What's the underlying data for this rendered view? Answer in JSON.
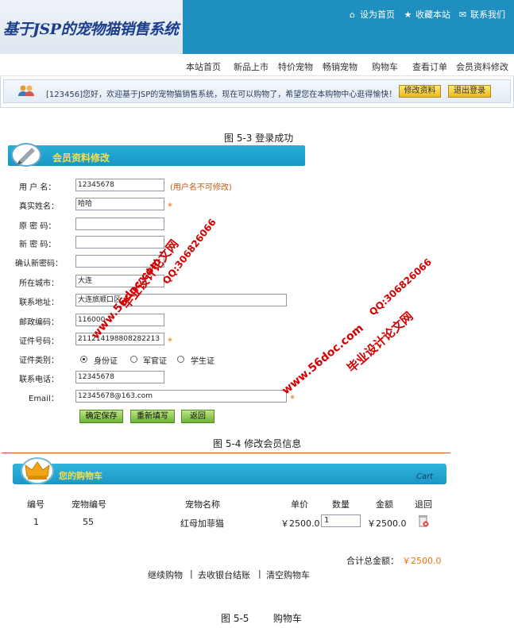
{
  "site": {
    "logo_text": "基于JSP的宠物猫销售系统",
    "toplinks": [
      {
        "icon": "home-icon",
        "label": "设为首页"
      },
      {
        "icon": "star-icon",
        "label": "收藏本站"
      },
      {
        "icon": "mail-icon",
        "label": "联系我们"
      }
    ],
    "nav": [
      "本站首页",
      "新品上市",
      "特价宠物",
      "畅销宠物",
      "购物车",
      "查看订单",
      "会员资料修改"
    ],
    "welcome": "[123456]您好，欢迎基于JSP的宠物猫销售系统，现在可以购物了，希望您在本购物中心逛得愉快！",
    "btn_edit": "修改资料",
    "btn_logout": "退出登录"
  },
  "captions": {
    "fig3": "图 5-3  登录成功",
    "fig4": "图 5-4  修改会员信息",
    "fig5": "图 5-5        购物车"
  },
  "form": {
    "title": "会员资料修改",
    "fields": [
      {
        "label": "用 户 名：",
        "value": "12345678",
        "note": "(用户名不可修改)"
      },
      {
        "label": "真实姓名：",
        "value": "哈哈",
        "required": "*"
      },
      {
        "label": "原 密 码：",
        "value": ""
      },
      {
        "label": "新 密 码：",
        "value": ""
      },
      {
        "label": "确认新密码：",
        "value": ""
      },
      {
        "label": "所在城市：",
        "value": "大连"
      },
      {
        "label": "联系地址：",
        "value": "大连旅顺口区"
      },
      {
        "label": "邮政编码：",
        "value": "116000"
      },
      {
        "label": "证件号码：",
        "value": "211214198808282213",
        "required": "*"
      },
      {
        "label": "证件类别：",
        "options": [
          "身份证",
          "军官证",
          "学生证"
        ],
        "selected": "身份证"
      },
      {
        "label": "联系电话：",
        "value": "12345678"
      },
      {
        "label": "Email：",
        "value": "12345678@163.com",
        "required": "*"
      }
    ],
    "buttons": [
      "确定保存",
      "重新填写",
      "返回"
    ],
    "watermarks": [
      "毕业设计论文网",
      "www.56doc.com",
      "QQ:306826066"
    ]
  },
  "cart": {
    "title": "您的购物车",
    "subtitle": "Cart",
    "headers": [
      "编号",
      "宠物编号",
      "宠物名称",
      "单价",
      "数量",
      "金额",
      "退回"
    ],
    "rows": [
      {
        "no": "1",
        "pet_no": "55",
        "name": "红母加菲猫",
        "price": "￥2500.0",
        "qty": "1",
        "amount": "￥2500.0"
      }
    ],
    "total_label": "合计总金额：",
    "total_value": "￥2500.0",
    "links": [
      "继续购物",
      "去收银台结账",
      "清空购物车"
    ],
    "separator": "|"
  },
  "colors": {
    "banner": "#1f8fbf",
    "accent": "#e8730c",
    "title_yellow": "#f4e04a",
    "watermark": "#d40000"
  }
}
